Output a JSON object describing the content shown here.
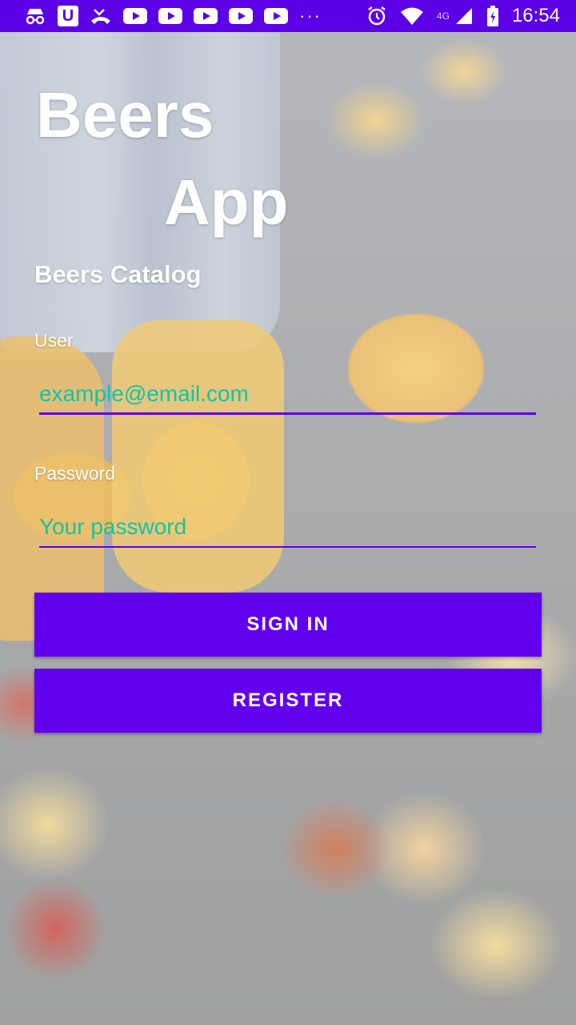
{
  "status_bar": {
    "time": "16:54",
    "network": "4G",
    "more": "···",
    "icons": [
      "incognito-icon",
      "u-app-icon",
      "missed-call-icon",
      "youtube-icon",
      "youtube-icon",
      "youtube-icon",
      "youtube-icon",
      "youtube-icon",
      "alarm-icon",
      "wifi-icon",
      "signal-icon",
      "battery-icon"
    ]
  },
  "app": {
    "title_line1": "Beers",
    "title_line2": "App",
    "subtitle": "Beers Catalog"
  },
  "form": {
    "user_label": "User",
    "user_placeholder": "example@email.com",
    "user_value": "",
    "password_label": "Password",
    "password_placeholder": "Your password",
    "password_value": ""
  },
  "buttons": {
    "sign_in": "SIGN IN",
    "register": "REGISTER"
  },
  "colors": {
    "primary": "#6200ee",
    "status_bar": "#5c00e6",
    "hint_text": "#11c4a8",
    "text_light": "#ffffff"
  }
}
